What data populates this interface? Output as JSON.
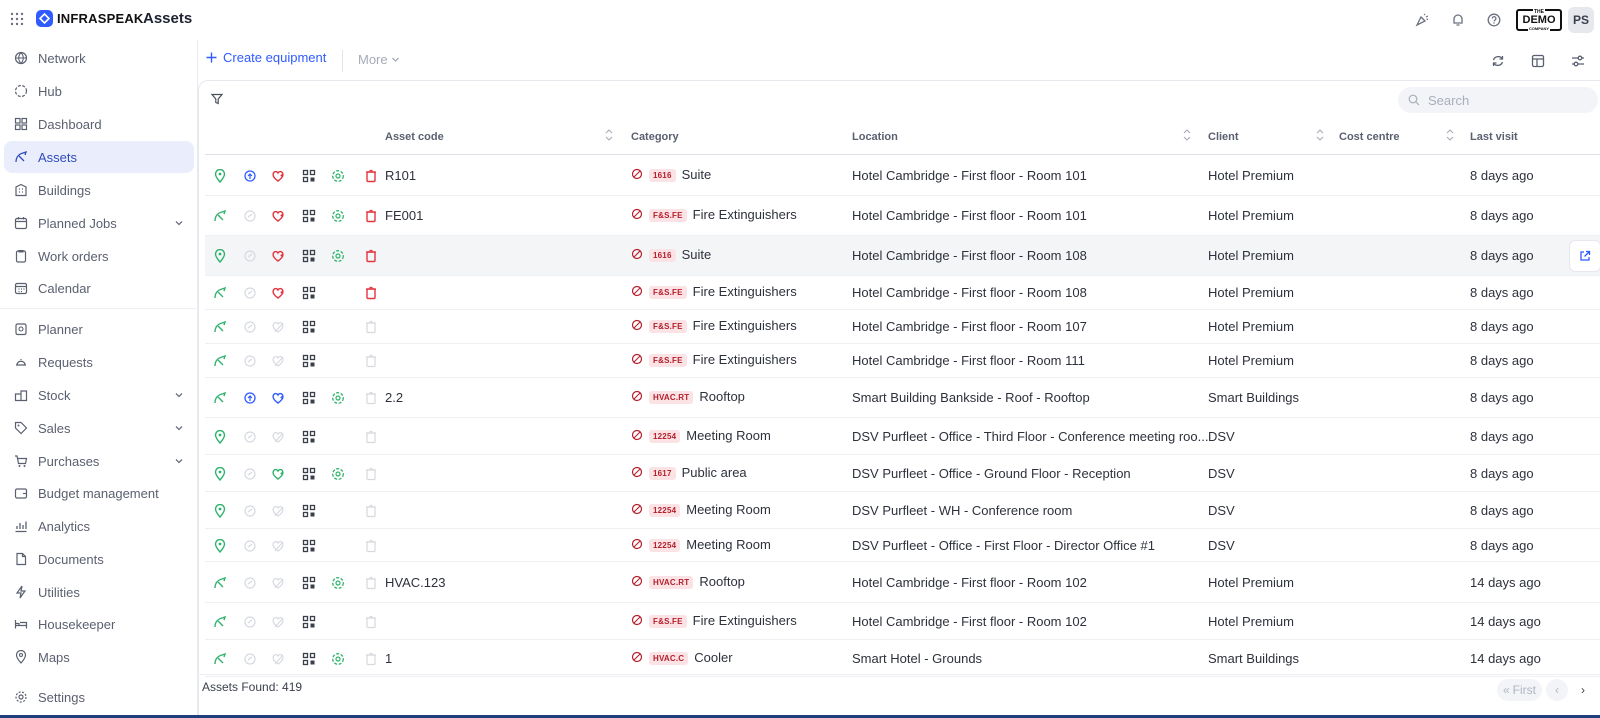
{
  "app": {
    "brand": "INFRASPEAK",
    "page_title": "Assets",
    "demo_badge": "DEMO",
    "demo_badge_top": "THE",
    "demo_badge_bottom": "COMPANY",
    "avatar_initials": "PS"
  },
  "sidebar": {
    "items": [
      {
        "label": "Network",
        "icon": "globe-icon"
      },
      {
        "label": "Hub",
        "icon": "hub-icon"
      },
      {
        "label": "Dashboard",
        "icon": "dashboard-icon"
      },
      {
        "label": "Assets",
        "icon": "assets-icon",
        "active": true
      },
      {
        "label": "Buildings",
        "icon": "building-icon"
      },
      {
        "label": "Planned Jobs",
        "icon": "calendar-check-icon",
        "expandable": true
      },
      {
        "label": "Work orders",
        "icon": "clipboard-icon"
      },
      {
        "label": "Calendar",
        "icon": "calendar-icon"
      },
      {
        "label": "Planner",
        "icon": "planner-icon"
      },
      {
        "label": "Requests",
        "icon": "bell-request-icon"
      },
      {
        "label": "Stock",
        "icon": "stock-icon",
        "expandable": true
      },
      {
        "label": "Sales",
        "icon": "tag-icon",
        "expandable": true
      },
      {
        "label": "Purchases",
        "icon": "cart-icon",
        "expandable": true
      },
      {
        "label": "Budget management",
        "icon": "wallet-icon"
      },
      {
        "label": "Analytics",
        "icon": "bar-chart-icon"
      },
      {
        "label": "Documents",
        "icon": "document-icon"
      },
      {
        "label": "Utilities",
        "icon": "bolt-icon"
      },
      {
        "label": "Housekeeper",
        "icon": "bed-icon"
      },
      {
        "label": "Maps",
        "icon": "map-pin-icon"
      },
      {
        "label": "Settings",
        "icon": "gear-icon"
      }
    ]
  },
  "toolbar": {
    "create_label": "Create equipment",
    "more_label": "More"
  },
  "search": {
    "placeholder": "Search"
  },
  "table": {
    "columns": {
      "asset_code": "Asset code",
      "category": "Category",
      "location": "Location",
      "client": "Client",
      "cost_centre": "Cost centre",
      "last_visit": "Last visit"
    },
    "rows": [
      {
        "code": "R101",
        "badge": "1616",
        "category": "Suite",
        "location": "Hotel Cambridge - First floor - Room 101",
        "client": "Hotel Premium",
        "last_visit": "8 days ago",
        "status": "pin",
        "icons": [
          "pin",
          "sync-blue",
          "heart-red",
          "qr",
          "cycle-green",
          "trash-red"
        ]
      },
      {
        "code": "FE001",
        "badge": "F&S.FE",
        "category": "Fire Extinguishers",
        "location": "Hotel Cambridge - First floor - Room 101",
        "client": "Hotel Premium",
        "last_visit": "8 days ago",
        "status": "asset",
        "icons": [
          "asset",
          "sync-grey",
          "heart-red",
          "qr",
          "cycle-green",
          "trash-red"
        ]
      },
      {
        "code": "",
        "badge": "1616",
        "category": "Suite",
        "location": "Hotel Cambridge - First floor - Room 108",
        "client": "Hotel Premium",
        "last_visit": "8 days ago",
        "status": "pin",
        "icons": [
          "pin",
          "sync-grey",
          "heart-red",
          "qr",
          "cycle-green",
          "trash-red"
        ],
        "hover": true
      },
      {
        "code": "",
        "badge": "F&S.FE",
        "category": "Fire Extinguishers",
        "location": "Hotel Cambridge - First floor - Room 108",
        "client": "Hotel Premium",
        "last_visit": "8 days ago",
        "status": "asset",
        "icons": [
          "asset",
          "sync-grey",
          "heart-red",
          "qr",
          "",
          "trash-red"
        ]
      },
      {
        "code": "",
        "badge": "F&S.FE",
        "category": "Fire Extinguishers",
        "location": "Hotel Cambridge - First floor - Room 107",
        "client": "Hotel Premium",
        "last_visit": "8 days ago",
        "status": "asset",
        "icons": [
          "asset",
          "sync-grey",
          "heart-grey",
          "qr",
          "",
          "trash-grey"
        ]
      },
      {
        "code": "",
        "badge": "F&S.FE",
        "category": "Fire Extinguishers",
        "location": "Hotel Cambridge - First floor - Room 111",
        "client": "Hotel Premium",
        "last_visit": "8 days ago",
        "status": "asset",
        "icons": [
          "asset",
          "sync-grey",
          "heart-grey",
          "qr",
          "",
          "trash-grey"
        ]
      },
      {
        "code": "2.2",
        "badge": "HVAC.RT",
        "category": "Rooftop",
        "location": "Smart Building Bankside - Roof - Rooftop",
        "client": "Smart Buildings",
        "last_visit": "8 days ago",
        "status": "asset",
        "icons": [
          "asset",
          "sync-blue",
          "heart-blue",
          "qr",
          "cycle-green",
          "trash-grey"
        ]
      },
      {
        "code": "",
        "badge": "12254",
        "category": "Meeting Room",
        "location": "DSV Purfleet - Office - Third Floor - Conference meeting roo...",
        "client": "DSV",
        "last_visit": "8 days ago",
        "status": "pin",
        "icons": [
          "pin",
          "sync-grey",
          "heart-grey",
          "qr",
          "",
          "trash-grey"
        ]
      },
      {
        "code": "",
        "badge": "1617",
        "category": "Public area",
        "location": "DSV Purfleet - Office - Ground Floor - Reception",
        "client": "DSV",
        "last_visit": "8 days ago",
        "status": "pin",
        "icons": [
          "pin",
          "sync-grey",
          "heart-green",
          "qr",
          "cycle-green",
          "trash-grey"
        ]
      },
      {
        "code": "",
        "badge": "12254",
        "category": "Meeting Room",
        "location": "DSV Purfleet - WH - Conference room",
        "client": "DSV",
        "last_visit": "8 days ago",
        "status": "pin",
        "icons": [
          "pin",
          "sync-grey",
          "heart-grey",
          "qr",
          "",
          "trash-grey"
        ]
      },
      {
        "code": "",
        "badge": "12254",
        "category": "Meeting Room",
        "location": "DSV Purfleet - Office - First Floor - Director Office #1",
        "client": "DSV",
        "last_visit": "8 days ago",
        "status": "pin",
        "icons": [
          "pin",
          "sync-grey",
          "heart-grey",
          "qr",
          "",
          "trash-grey"
        ]
      },
      {
        "code": "HVAC.123",
        "badge": "HVAC.RT",
        "category": "Rooftop",
        "location": "Hotel Cambridge - First floor - Room 102",
        "client": "Hotel Premium",
        "last_visit": "14 days ago",
        "status": "asset",
        "icons": [
          "asset",
          "sync-grey",
          "heart-grey",
          "qr",
          "cycle-green",
          "trash-grey"
        ]
      },
      {
        "code": "",
        "badge": "F&S.FE",
        "category": "Fire Extinguishers",
        "location": "Hotel Cambridge - First floor - Room 102",
        "client": "Hotel Premium",
        "last_visit": "14 days ago",
        "status": "asset",
        "icons": [
          "asset",
          "sync-grey",
          "heart-grey",
          "qr",
          "",
          "trash-grey"
        ]
      },
      {
        "code": "1",
        "badge": "HVAC.C",
        "category": "Cooler",
        "location": "Smart Hotel - Grounds",
        "client": "Smart Buildings",
        "last_visit": "14 days ago",
        "status": "asset",
        "icons": [
          "asset",
          "sync-grey",
          "heart-grey",
          "qr",
          "cycle-green",
          "trash-grey"
        ]
      }
    ]
  },
  "footer": {
    "assets_found": "Assets Found: 419",
    "first_label": "First"
  },
  "colors": {
    "accent": "#2f5bff",
    "active_bg": "#eaeefc",
    "green": "#2fb36c",
    "red": "#e5333f",
    "blue": "#2f5bff",
    "badge_bg": "#fbe3e5",
    "badge_text": "#b51e2b"
  }
}
